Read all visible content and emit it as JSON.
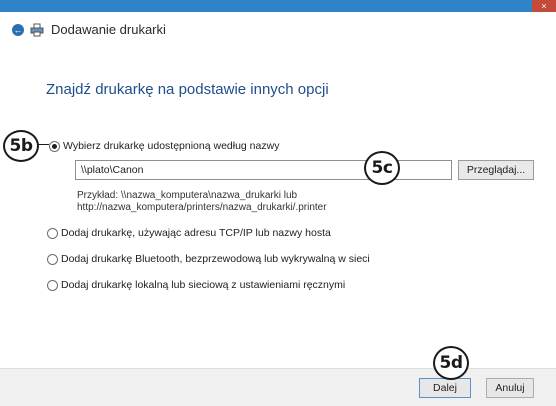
{
  "window": {
    "title": "Dodawanie drukarki",
    "close_glyph": "×",
    "back_glyph": "←"
  },
  "heading": "Znajdź drukarkę na podstawie innych opcji",
  "options": [
    {
      "label": "Wybierz drukarkę udostępnioną według nazwy",
      "selected": true
    },
    {
      "label": "Dodaj drukarkę, używając adresu TCP/IP lub nazwy hosta",
      "selected": false
    },
    {
      "label": "Dodaj drukarkę Bluetooth, bezprzewodową lub wykrywalną w sieci",
      "selected": false
    },
    {
      "label": "Dodaj drukarkę lokalną lub sieciową z ustawieniami ręcznymi",
      "selected": false
    }
  ],
  "share_path": {
    "value": "\\\\plato\\Canon",
    "browse_label": "Przeglądaj..."
  },
  "example": {
    "line1": "Przykład: \\\\nazwa_komputera\\nazwa_drukarki lub",
    "line2": "http://nazwa_komputera/printers/nazwa_drukarki/.printer"
  },
  "buttons": {
    "next": "Dalej",
    "cancel": "Anuluj"
  },
  "callouts": {
    "a": "5b",
    "b": "5c",
    "c": "5d"
  },
  "icons": {
    "back": "back-arrow-icon",
    "printer": "printer-icon",
    "close": "close-icon"
  },
  "colors": {
    "titlebar": "#2f83c9",
    "close": "#c44a3c",
    "heading": "#1f4e8c"
  }
}
